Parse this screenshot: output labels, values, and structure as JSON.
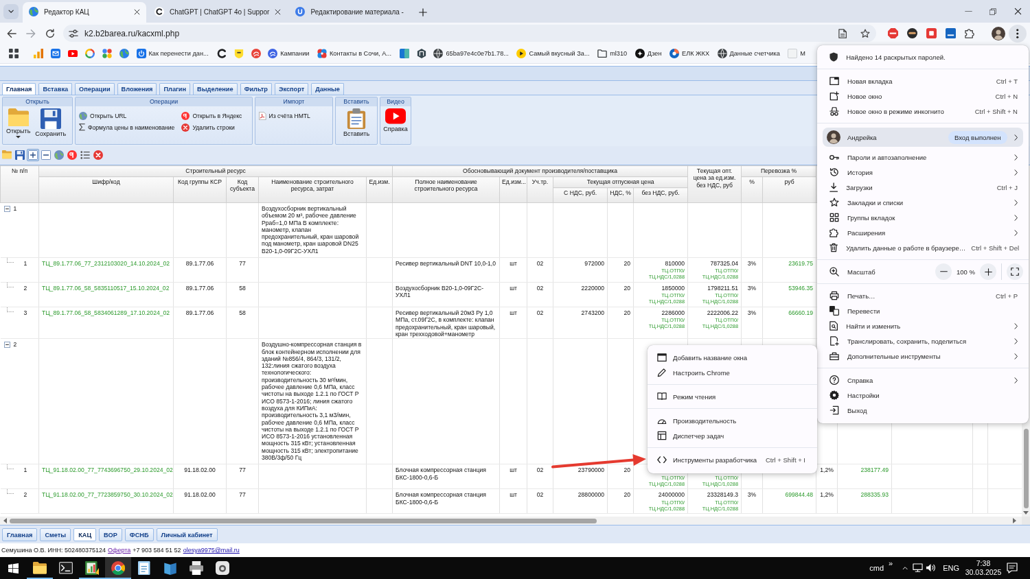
{
  "browser": {
    "tabs": [
      {
        "title": "Редактор КАЦ",
        "selected": true,
        "closable": true
      },
      {
        "title": "ChatGPT | ChatGPT 4o | Suppor",
        "selected": false,
        "closable": true
      },
      {
        "title": "Редактирование материала -",
        "selected": false,
        "closable": false
      }
    ],
    "url": "k2.b2barea.ru/kacxml.php",
    "menu_open": true,
    "bookmarks": [
      {
        "kind": "icon"
      },
      {
        "kind": "icon"
      },
      {
        "kind": "icon"
      },
      {
        "kind": "icon"
      },
      {
        "kind": "icon"
      },
      {
        "kind": "icon"
      },
      {
        "kind": "icon"
      },
      {
        "kind": "link",
        "label": "Как перенести дан..."
      },
      {
        "kind": "icon"
      },
      {
        "kind": "icon"
      },
      {
        "kind": "icon"
      },
      {
        "kind": "link",
        "label": "Кампании"
      },
      {
        "kind": "link",
        "label": "Контакты в Сочи, А..."
      },
      {
        "kind": "icon"
      },
      {
        "kind": "icon"
      },
      {
        "kind": "link",
        "label": "65ba97e4c0e7b1.78..."
      },
      {
        "kind": "link",
        "label": "Самый вкусный За..."
      },
      {
        "kind": "link",
        "label": "ml310"
      },
      {
        "kind": "link",
        "label": "Дзен"
      },
      {
        "kind": "link",
        "label": "ЕЛК ЖКХ"
      },
      {
        "kind": "link",
        "label": "Данные счетчика"
      },
      {
        "kind": "link",
        "label": "M"
      }
    ]
  },
  "app": {
    "ribbon_tabs": [
      {
        "label": "Главная",
        "selected": true
      },
      {
        "label": "Вставка",
        "selected": false
      },
      {
        "label": "Операции",
        "selected": false
      },
      {
        "label": "Вложения",
        "selected": false
      },
      {
        "label": "Плагин",
        "selected": false
      },
      {
        "label": "Выделение",
        "selected": false
      },
      {
        "label": "Фильтр",
        "selected": false
      },
      {
        "label": "Экспорт",
        "selected": false
      },
      {
        "label": "Данные",
        "selected": false
      }
    ],
    "ribbon_groups": [
      {
        "title": "Открыть",
        "buttons": [
          {
            "kind": "large",
            "label": "Открыть",
            "dropdown": true
          },
          {
            "kind": "large",
            "label": "Сохранить",
            "dropdown": false
          }
        ]
      },
      {
        "title": "Операции",
        "buttons": [
          {
            "kind": "small",
            "label": "Открыть URL"
          },
          {
            "kind": "small",
            "label": "Формула цены в наименование"
          },
          {
            "kind": "small",
            "label": "Открыть в Яндекс"
          },
          {
            "kind": "small",
            "label": "Удалить строки"
          }
        ]
      },
      {
        "title": "Импорт",
        "buttons": [
          {
            "kind": "small",
            "label": "Из счёта HMTL"
          }
        ]
      },
      {
        "title": "Вставить",
        "buttons": [
          {
            "kind": "large",
            "label": "Вставить",
            "dropdown": false
          }
        ]
      },
      {
        "title": "Видео",
        "buttons": [
          {
            "kind": "large",
            "label": "Справка",
            "dropdown": false
          }
        ]
      }
    ],
    "toolbar": [
      {
        "pressed": false
      },
      {
        "pressed": false
      },
      {
        "pressed": true
      },
      {
        "pressed": false
      },
      {
        "pressed": false
      },
      {
        "pressed": false
      },
      {
        "pressed": false
      },
      {
        "pressed": false
      }
    ],
    "table": {
      "columns": [
        {
          "label": "№ п/п"
        },
        {
          "label": "Строительный ресурс",
          "children": [
            {
              "label": "Шифр/код"
            },
            {
              "label": "Код группы КСР"
            },
            {
              "label": "Код субъекта"
            },
            {
              "label": "Наименование строительного ресурса, затрат"
            },
            {
              "label": "Ед.изм."
            }
          ]
        },
        {
          "label": "Обосновывающий документ производителя/поставщика",
          "children": [
            {
              "label": "Полное наименование строительного ресурса"
            },
            {
              "label": "Ед.изм..."
            },
            {
              "label": "Уч.тр."
            },
            {
              "label": "Текущая отпускная цена",
              "children": [
                {
                  "label": "С НДС, руб."
                },
                {
                  "label": "НДС, %"
                },
                {
                  "label": "без НДС, руб."
                }
              ]
            }
          ]
        },
        {
          "label": "Текущая опт. цена за ед.изм. без НДС, руб"
        },
        {
          "label": "Перевозка %",
          "children": [
            {
              "label": "%"
            },
            {
              "label": "руб"
            }
          ]
        }
      ],
      "rows": [
        {
          "number": "1",
          "expanded": true,
          "resource_name": "Воздухосборник вертикальный объемом 20 м³, рабочее давление Рраб=1,0 МПа В комплекте: манометр, клапан предохранительный, кран шаровой под манометр, кран шаровой DN25 В20-1,0-09Г2С-УХЛ1",
          "children": [
            {
              "number": "1",
              "code": "ТЦ_89.1.77.06_77_2312103020_14.10.2024_02",
              "ksr_group": "89.1.77.06",
              "subject_code": "77",
              "full_name": "Ресивер вертикальный DNT 10,0-1,0",
              "doc_unit": "шт",
              "uch_tr": "02",
              "price_with_vat": "972000",
              "vat_percent": "20",
              "price_without_vat": "810000",
              "price_without_vat_formula": [
                "ТЦ.ОТП0/",
                "ТЦ.НДС/1,0288"
              ],
              "wholesale_price": "787325.04",
              "wholesale_price_formula": [
                "ТЦ.ОТП0/",
                "ТЦ.НДС/1,0288"
              ],
              "transport_percent": "3%",
              "transport_rub": "23619.75"
            },
            {
              "number": "2",
              "code": "ТЦ_89.1.77.06_58_5835110517_15.10.2024_02",
              "ksr_group": "89.1.77.06",
              "subject_code": "58",
              "full_name": "Воздухосборник В20-1,0-09Г2С-УХЛ1",
              "doc_unit": "шт",
              "uch_tr": "02",
              "price_with_vat": "2220000",
              "vat_percent": "20",
              "price_without_vat": "1850000",
              "price_without_vat_formula": [
                "ТЦ.ОТП0/",
                "ТЦ.НДС/1,0288"
              ],
              "wholesale_price": "1798211.51",
              "wholesale_price_formula": [
                "ТЦ.ОТП0/",
                "ТЦ.НДС/1,0288"
              ],
              "transport_percent": "3%",
              "transport_rub": "53946.35"
            },
            {
              "number": "3",
              "code": "ТЦ_89.1.77.06_58_5834061289_17.10.2024_02",
              "ksr_group": "89.1.77.06",
              "subject_code": "58",
              "full_name": "Ресивер вертикальный 20м3 Ру 1,0 МПа, ст.09Г2С, в комплекте: клапан предохранительный, кран шаровый, кран трехходовой+манометр",
              "doc_unit": "шт",
              "uch_tr": "02",
              "price_with_vat": "2743200",
              "vat_percent": "20",
              "price_without_vat": "2286000",
              "price_without_vat_formula": [
                "ТЦ.ОТП0/",
                "ТЦ.НДС/1,0288"
              ],
              "wholesale_price": "2222006.22",
              "wholesale_price_formula": [
                "ТЦ.ОТП0/",
                "ТЦ.НДС/1,0288"
              ],
              "transport_percent": "3%",
              "transport_rub": "66660.19"
            }
          ]
        },
        {
          "number": "2",
          "expanded": true,
          "resource_name": "Воздушно-компрессорная станция в блок контейнерном исполнении для зданий №856/4, 864/3, 131/2, 132:линия сжатого воздуха технологического: производительность 30 м³/мин, рабочее давление 0,6 МПа, класс чистоты на выходе 1.2.1 по ГОСТ Р ИСО 8573-1-2016; линия сжатого воздуха для КИПиА: производительность 3,1 м3/мин, рабочее давление 0,6 МПа, класс чистоты на выходе 1.2.1 по ГОСТ Р ИСО 8573-1-2016 установленная мощность 315 кВт; установленная мощность 315 кВт; электропитание 380В/3ф/50 Гц",
          "children": [
            {
              "number": "1",
              "code": "ТЦ_91.18.02.00_77_7743696750_29.10.2024_02",
              "ksr_group": "91.18.02.00",
              "subject_code": "77",
              "full_name": "Блочная компрессорная станция БКС-1800-0,6-Б",
              "doc_unit": "шт",
              "uch_tr": "02",
              "price_with_vat": "23790000",
              "vat_percent": "20",
              "price_without_vat_formula": [
                "ТЦ.ОТП0/",
                "ТЦ.НДС/1,0288"
              ],
              "wholesale_price_formula": [
                "ТЦ.ОТП0/",
                "ТЦ.НДС/1,0288"
              ],
              "column_16": "1,2%",
              "column_17": "238177.49"
            },
            {
              "number": "2",
              "code": "ТЦ_91.18.02.00_77_7723859750_30.10.2024_02",
              "ksr_group": "91.18.02.00",
              "subject_code": "77",
              "full_name": "Блочная компрессорная станция БКС-1800-0,6-Б",
              "doc_unit": "шт",
              "uch_tr": "02",
              "price_with_vat": "28800000",
              "vat_percent": "20",
              "price_without_vat": "24000000",
              "price_without_vat_formula": [
                "ТЦ.ОТП0/",
                "ТЦ.НДС/1,0288"
              ],
              "wholesale_price": "23328149.3",
              "wholesale_price_formula": [
                "ТЦ.ОТП0/",
                "ТЦ.НДС/1,0288"
              ],
              "transport_percent": "3%",
              "transport_rub": "699844.48",
              "column_16": "1,2%",
              "column_17": "288335.93"
            }
          ]
        }
      ]
    },
    "bottom_tabs": [
      {
        "label": "Главная",
        "selected": false
      },
      {
        "label": "Сметы",
        "selected": false
      },
      {
        "label": "КАЦ",
        "selected": true
      },
      {
        "label": "ВОР",
        "selected": false
      },
      {
        "label": "ФСНБ",
        "selected": false
      },
      {
        "label": "Личный кабинет",
        "selected": false
      }
    ],
    "status": [
      {
        "kind": "text",
        "text": "Семушина О.В. ИНН: 502480375124"
      },
      {
        "kind": "link",
        "text": "Оферта",
        "visited": true
      },
      {
        "kind": "text",
        "text": "+7 903 584 51 52"
      },
      {
        "kind": "link",
        "text": "olesya9975@mail.ru",
        "visited": false
      }
    ]
  },
  "chrome_menu": {
    "sections": [
      [
        {
          "kind": "item",
          "label": "Найдено 14 раскрытых паролей.",
          "submenu": false,
          "highlighted": false
        }
      ],
      [
        {
          "kind": "item",
          "label": "Новая вкладка",
          "shortcut": "Ctrl + T",
          "submenu": false,
          "highlighted": false
        },
        {
          "kind": "item",
          "label": "Новое окно",
          "shortcut": "Ctrl + N",
          "submenu": false,
          "highlighted": false
        },
        {
          "kind": "item",
          "label": "Новое окно в режиме инкогнито",
          "shortcut": "Ctrl + Shift + N",
          "submenu": false,
          "highlighted": false
        }
      ],
      [
        {
          "kind": "profile",
          "label": "Андрейка",
          "status": "Вход выполнен",
          "submenu": true,
          "highlighted": true
        },
        {
          "kind": "item",
          "label": "Пароли и автозаполнение",
          "submenu": true,
          "highlighted": false
        },
        {
          "kind": "item",
          "label": "История",
          "submenu": true,
          "highlighted": false
        },
        {
          "kind": "item",
          "label": "Загрузки",
          "shortcut": "Ctrl + J",
          "submenu": false,
          "highlighted": false
        },
        {
          "kind": "item",
          "label": "Закладки и списки",
          "submenu": true,
          "highlighted": false
        },
        {
          "kind": "item",
          "label": "Группы вкладок",
          "submenu": true,
          "highlighted": false
        },
        {
          "kind": "item",
          "label": "Расширения",
          "submenu": true,
          "highlighted": false
        },
        {
          "kind": "item",
          "label": "Удалить данные о работе в браузере…",
          "shortcut": "Ctrl + Shift + Del",
          "submenu": false,
          "highlighted": false
        }
      ],
      [
        {
          "kind": "zoom",
          "label": "Масштаб",
          "value": "100 %"
        }
      ],
      [
        {
          "kind": "item",
          "label": "Печать…",
          "shortcut": "Ctrl + P",
          "submenu": false,
          "highlighted": false
        },
        {
          "kind": "item",
          "label": "Перевести",
          "submenu": false,
          "highlighted": false
        },
        {
          "kind": "item",
          "label": "Найти и изменить",
          "submenu": true,
          "highlighted": false
        },
        {
          "kind": "item",
          "label": "Транслировать, сохранить, поделиться",
          "submenu": true,
          "highlighted": false
        },
        {
          "kind": "item",
          "label": "Дополнительные инструменты",
          "submenu": true,
          "highlighted": false
        }
      ],
      [
        {
          "kind": "item",
          "label": "Справка",
          "submenu": true,
          "highlighted": false
        },
        {
          "kind": "item",
          "label": "Настройки",
          "submenu": false,
          "highlighted": false
        },
        {
          "kind": "item",
          "label": "Выход",
          "submenu": false,
          "highlighted": false
        }
      ]
    ]
  },
  "submenu": {
    "sections": [
      [
        {
          "label": "Добавить название окна"
        },
        {
          "label": "Настроить Chrome"
        }
      ],
      [
        {
          "label": "Режим чтения"
        }
      ],
      [
        {
          "label": "Производительность"
        },
        {
          "label": "Диспетчер задач"
        }
      ],
      [
        {
          "label": "Инструменты разработчика",
          "shortcut": "Ctrl + Shift + I"
        }
      ]
    ]
  },
  "taskbar": {
    "apps": [
      {
        "running": true,
        "selected": false
      },
      {
        "running": false,
        "selected": false
      },
      {
        "running": true,
        "selected": false
      },
      {
        "running": true,
        "selected": true
      },
      {
        "running": false,
        "selected": false
      },
      {
        "running": false,
        "selected": false
      },
      {
        "running": false,
        "selected": false
      },
      {
        "running": false,
        "selected": false
      }
    ],
    "toolbar_label": "cmd",
    "overflow": "»",
    "language": "ENG",
    "time": "7:38",
    "date": "30.03.2025"
  }
}
